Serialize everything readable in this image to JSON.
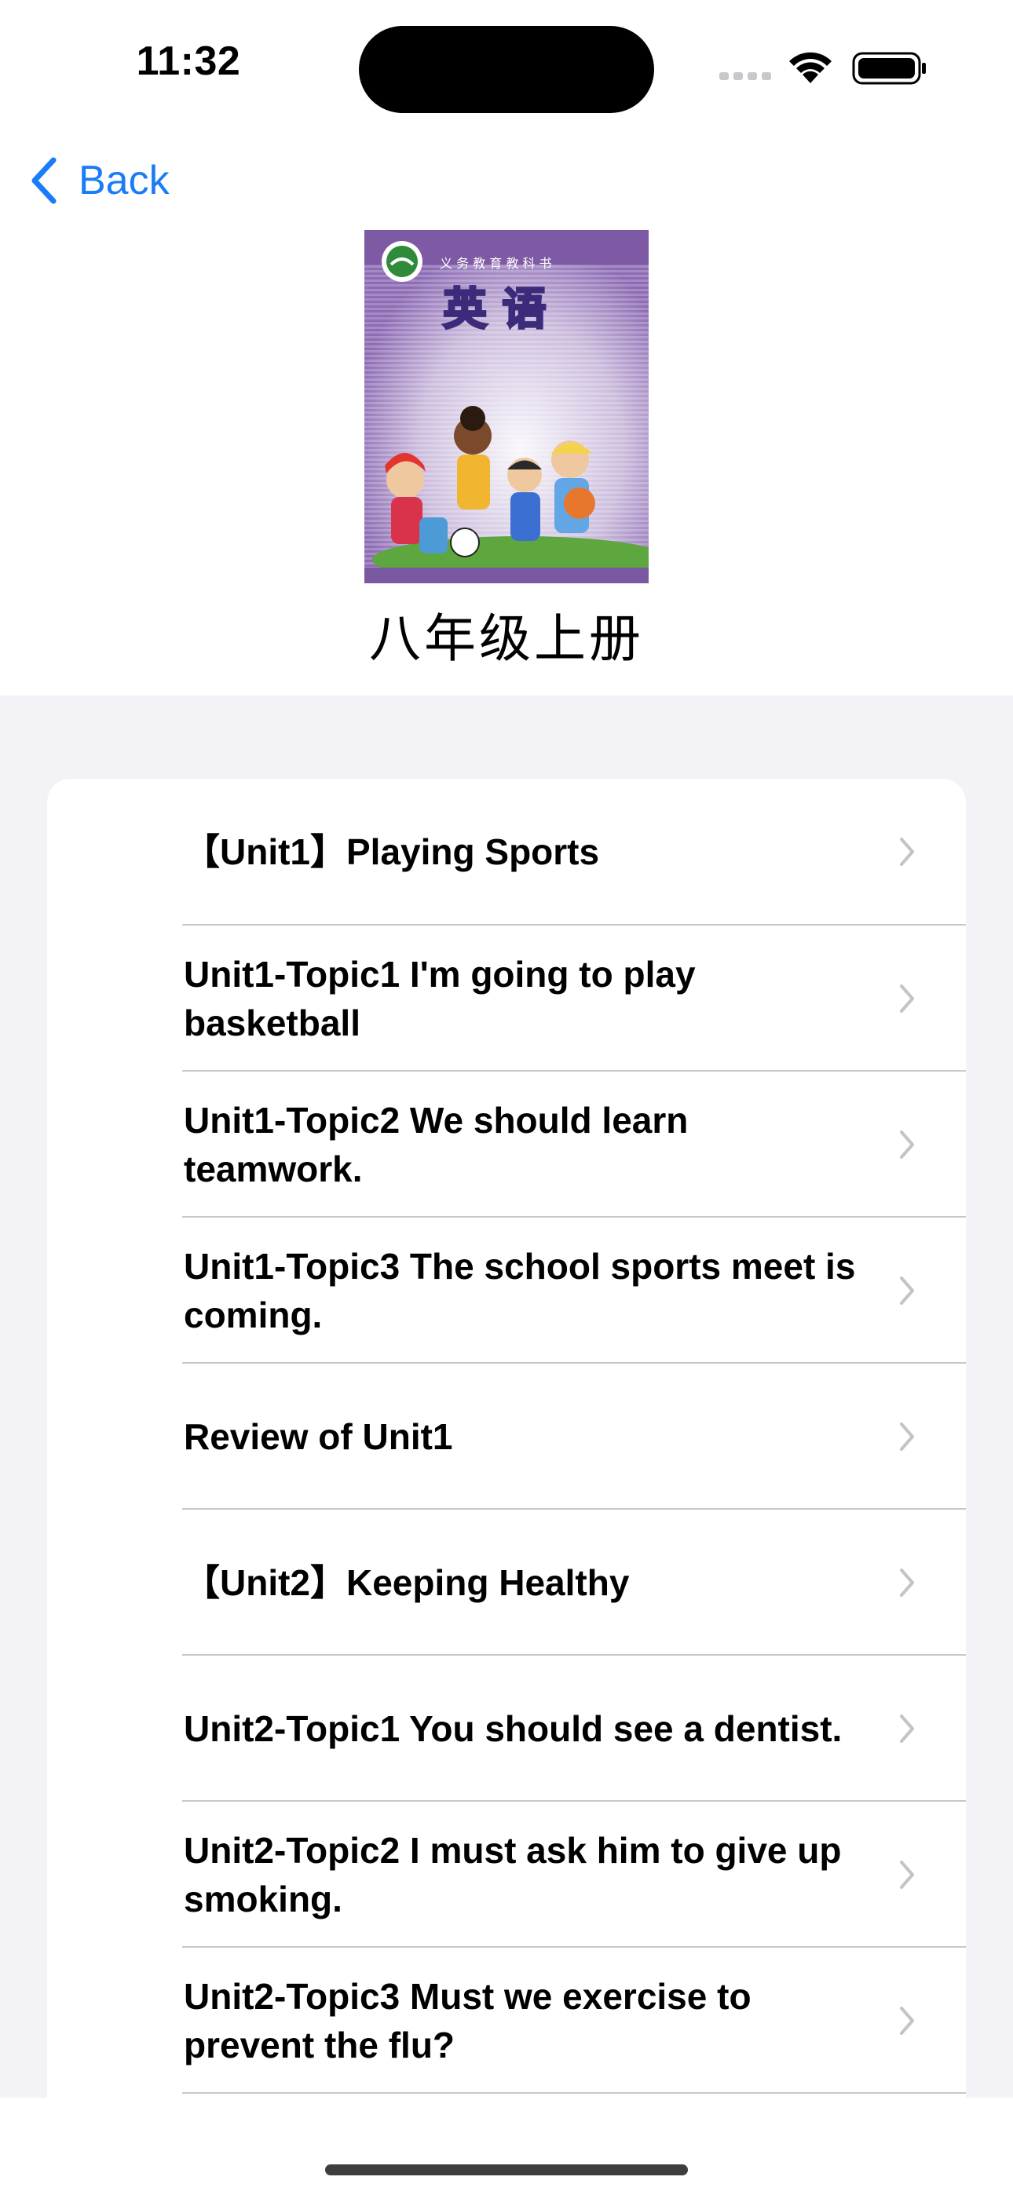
{
  "status": {
    "time": "11:32"
  },
  "nav": {
    "back_label": "Back"
  },
  "book": {
    "title": "八年级上册",
    "cover_heading": "英 语",
    "cover_small": "义 务 教 育 教 科 书"
  },
  "lessons": [
    {
      "label": "【Unit1】Playing Sports"
    },
    {
      "label": "Unit1-Topic1 I'm going to play basketball"
    },
    {
      "label": "Unit1-Topic2 We should learn teamwork."
    },
    {
      "label": "Unit1-Topic3 The school sports meet is coming."
    },
    {
      "label": "Review of Unit1"
    },
    {
      "label": "【Unit2】Keeping Healthy"
    },
    {
      "label": "Unit2-Topic1 You should see a dentist."
    },
    {
      "label": "Unit2-Topic2 I must ask him to give up smoking."
    },
    {
      "label": "Unit2-Topic3 Must we exercise to prevent the flu?"
    }
  ],
  "colors": {
    "accent": "#1a7cf6",
    "grouped_background": "#f2f2f7",
    "chevron": "#c4c4c7",
    "cover_purple": "#8a6aae"
  },
  "icons": {
    "back": "chevron-left-icon",
    "row": "chevron-right-icon"
  }
}
